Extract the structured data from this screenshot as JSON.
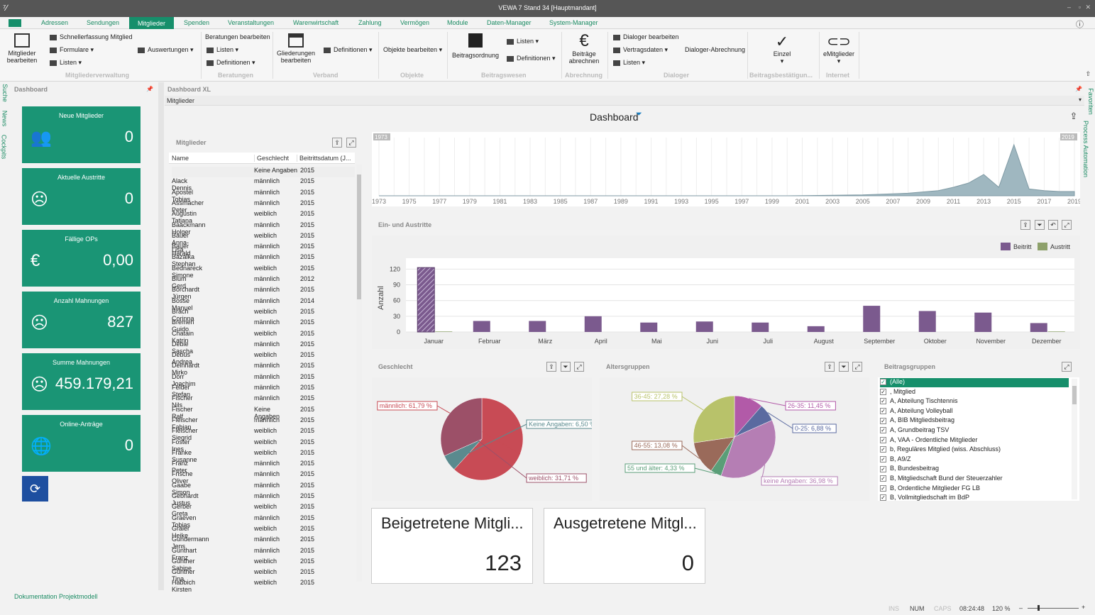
{
  "window": {
    "title": "VEWA 7 Stand 34 [Hauptmandant]"
  },
  "menu": [
    "Adressen",
    "Sendungen",
    "Mitglieder",
    "Spenden",
    "Veranstaltungen",
    "Warenwirtschaft",
    "Zahlung",
    "Vermögen",
    "Module",
    "Daten-Manager",
    "System-Manager"
  ],
  "ribbon": {
    "mitglieder_bearbeiten": "Mitglieder bearbeiten",
    "schnellerfassung": "Schnellerfassung Mitglied",
    "formulare": "Formulare",
    "listen1": "Listen",
    "auswertungen": "Auswertungen",
    "grp1": "Mitgliederverwaltung",
    "beratungen_bearbeiten": "Beratungen bearbeiten",
    "listen2": "Listen",
    "definitionen2": "Definitionen",
    "grp2": "Beratungen",
    "gliederungen": "Gliederungen bearbeiten",
    "definitionen3": "Definitionen",
    "grp3": "Verband",
    "objekte": "Objekte bearbeiten",
    "grp4": "Objekte",
    "beitragsordnung": "Beitragsordnung",
    "listen5": "Listen",
    "definitionen5": "Definitionen",
    "grp5": "Beitragswesen",
    "beitraege": "Beiträge abrechnen",
    "grp6": "Abrechnung",
    "dialoger_bearbeiten": "Dialoger bearbeiten",
    "vertragsdaten": "Vertragsdaten",
    "listen7": "Listen",
    "dialoger_abrechnung": "Dialoger-Abrechnung",
    "grp7": "Dialoger",
    "einzel": "Einzel",
    "grp8": "Beitragsbestätigun...",
    "emitglieder": "eMitglieder",
    "grp9": "Internet"
  },
  "side_tabs": [
    "Suche",
    "News",
    "Cockpits"
  ],
  "right_tabs": [
    "Favoriten",
    "Process Automation"
  ],
  "dashboard_panel": {
    "title": "Dashboard"
  },
  "tiles": [
    {
      "label": "Neue Mitglieder",
      "value": "0",
      "icon": "users-icon"
    },
    {
      "label": "Aktuelle Austritte",
      "value": "0",
      "icon": "sad-face-icon"
    },
    {
      "label": "Fällige OPs",
      "value": "0,00",
      "icon": "euro-icon"
    },
    {
      "label": "Anzahl Mahnungen",
      "value": "827",
      "icon": "angry-face-icon"
    },
    {
      "label": "Summe Mahnungen",
      "value": "459.179,21",
      "icon": "angry-face-icon"
    },
    {
      "label": "Online-Anträge",
      "value": "0",
      "icon": "globe-icon"
    }
  ],
  "doc_link": "Dokumentation Projektmodell",
  "dashxl": {
    "title": "Dashboard XL",
    "filter": "Mitglieder",
    "heading": "Dashboard"
  },
  "members": {
    "title": "Mitglieder",
    "columns": [
      "Name",
      "Geschlecht",
      "Beitrittsdatum (J..."
    ],
    "rows": [
      [
        "",
        "Keine Angaben",
        "2015"
      ],
      [
        "Alack Dennis",
        "männlich",
        "2015"
      ],
      [
        "Apostel Tobias",
        "männlich",
        "2015"
      ],
      [
        "Assmacher Peter",
        "männlich",
        "2015"
      ],
      [
        "Augustin Tatjana",
        "weiblich",
        "2015"
      ],
      [
        "Baackmann Holger",
        "männlich",
        "2015"
      ],
      [
        "Bauer Anna-Lisa",
        "weiblich",
        "2015"
      ],
      [
        "Bauer Harald",
        "männlich",
        "2015"
      ],
      [
        "Bazalka Stephan",
        "männlich",
        "2015"
      ],
      [
        "Bednareck Simone",
        "weiblich",
        "2015"
      ],
      [
        "Blum Gerd",
        "männlich",
        "2012"
      ],
      [
        "Borchardt Jürgen",
        "männlich",
        "2015"
      ],
      [
        "Bosse Manuel",
        "männlich",
        "2014"
      ],
      [
        "Brach Corinna",
        "weiblich",
        "2015"
      ],
      [
        "Bremen Guido",
        "männlich",
        "2015"
      ],
      [
        "Chatain Katrin",
        "weiblich",
        "2015"
      ],
      [
        "Debie Sascha",
        "männlich",
        "2015"
      ],
      [
        "Debus Andrea",
        "weiblich",
        "2015"
      ],
      [
        "Deinhardt Mirko",
        "männlich",
        "2015"
      ],
      [
        "Dörr Joachim",
        "männlich",
        "2015"
      ],
      [
        "Felder Stefan",
        "männlich",
        "2015"
      ],
      [
        "Fischer Nils",
        "männlich",
        "2015"
      ],
      [
        "Fischer Ralf",
        "Keine Angaben",
        "2015"
      ],
      [
        "Fleischer Fabian",
        "männlich",
        "2015"
      ],
      [
        "Fleischer Siegrid",
        "weiblich",
        "2015"
      ],
      [
        "Foster Ines",
        "weiblich",
        "2015"
      ],
      [
        "Franke Susanne",
        "weiblich",
        "2015"
      ],
      [
        "Franz Peter",
        "männlich",
        "2015"
      ],
      [
        "Frische Oliver",
        "männlich",
        "2015"
      ],
      [
        "Gaabe Simon",
        "männlich",
        "2015"
      ],
      [
        "Gebhardt Justus",
        "männlich",
        "2015"
      ],
      [
        "Gerber Greta",
        "weiblich",
        "2015"
      ],
      [
        "Graeven Tobias",
        "männlich",
        "2015"
      ],
      [
        "Gräler Heike",
        "weiblich",
        "2015"
      ],
      [
        "Gundermann Jens",
        "männlich",
        "2015"
      ],
      [
        "Günthart Franz",
        "männlich",
        "2015"
      ],
      [
        "Günther Sabine",
        "weiblich",
        "2015"
      ],
      [
        "Günther Tina",
        "weiblich",
        "2015"
      ],
      [
        "Habbich Kirsten",
        "weiblich",
        "2015"
      ]
    ]
  },
  "chart_data": [
    {
      "type": "area",
      "title": "",
      "x_ticks": [
        "1973",
        "1975",
        "1977",
        "1979",
        "1981",
        "1983",
        "1985",
        "1987",
        "1989",
        "1991",
        "1993",
        "1995",
        "1997",
        "1999",
        "2001",
        "2003",
        "2005",
        "2007",
        "2009",
        "2011",
        "2013",
        "2015",
        "2017",
        "2019"
      ],
      "range_labels": [
        "1973",
        "2019"
      ],
      "x": [
        1973,
        2000,
        2005,
        2008,
        2010,
        2011,
        2012,
        2013,
        2014,
        2015,
        2016,
        2017,
        2018,
        2019
      ],
      "values": [
        0,
        0,
        1,
        3,
        6,
        10,
        15,
        25,
        10,
        60,
        8,
        6,
        5,
        5
      ]
    },
    {
      "type": "bar",
      "title": "Ein- und Austritte",
      "ylabel": "Anzahl",
      "categories": [
        "Januar",
        "Februar",
        "März",
        "April",
        "Mai",
        "Juni",
        "Juli",
        "August",
        "September",
        "Oktober",
        "November",
        "Dezember"
      ],
      "yticks": [
        "0",
        "30",
        "60",
        "90",
        "120"
      ],
      "ylim": [
        0,
        130
      ],
      "series": [
        {
          "name": "Beitritt",
          "values": [
            123,
            21,
            21,
            30,
            18,
            20,
            18,
            11,
            50,
            40,
            37,
            17
          ]
        },
        {
          "name": "Austritt",
          "values": [
            1,
            0,
            0,
            0,
            0,
            0,
            0,
            0,
            0,
            0,
            0,
            1
          ]
        }
      ],
      "colors": [
        "#7b5a8e",
        "#8ea16b"
      ]
    },
    {
      "type": "pie",
      "title": "Geschlecht",
      "labels": [
        "männlich: 61,79 %",
        "Keine Angaben: 6,50 %",
        "weiblich: 31,71 %"
      ],
      "values": [
        61.79,
        6.5,
        31.71
      ],
      "colors": [
        "#c84b55",
        "#5a8a8e",
        "#9c5068"
      ]
    },
    {
      "type": "pie",
      "title": "Altersgruppen",
      "labels": [
        "26-35: 11,45 %",
        "0-25: 6,88 %",
        "keine Angaben: 36,98 %",
        "55 und älter: 4,33 %",
        "46-55: 13,08 %",
        "36-45: 27,28 %"
      ],
      "values": [
        11.45,
        6.88,
        36.98,
        4.33,
        13.08,
        27.28
      ],
      "colors": [
        "#b25aa8",
        "#5a6aa0",
        "#b57eb4",
        "#5a9e78",
        "#9a6a5a",
        "#b8c26a"
      ]
    }
  ],
  "beitragsgruppen": {
    "title": "Beitragsgruppen",
    "items": [
      "(Alle)",
      ", Mitglied",
      "A, Abteilung Tischtennis",
      "A, Abteilung Volleyball",
      "A, BIB Mitgliedsbeitrag",
      "A, Grundbeitrag TSV",
      "A, VAA - Ordentliche Mitglieder",
      "b, Reguläres Mitglied (wiss. Abschluss)",
      "B, A9/Z",
      "B, Bundesbeitrag",
      "B, Mitgliedschaft Bund der Steuerzahler",
      "B, Ordentliche Mitglieder FG LB",
      "B, Vollmitgliedschaft im BdP"
    ]
  },
  "kpis": [
    {
      "title": "Beigetretene Mitgli...",
      "value": "123"
    },
    {
      "title": "Ausgetretene Mitgl...",
      "value": "0"
    }
  ],
  "status": {
    "ins": "INS",
    "num": "NUM",
    "caps": "CAPS",
    "time": "08:24:48",
    "zoom": "120 %"
  }
}
